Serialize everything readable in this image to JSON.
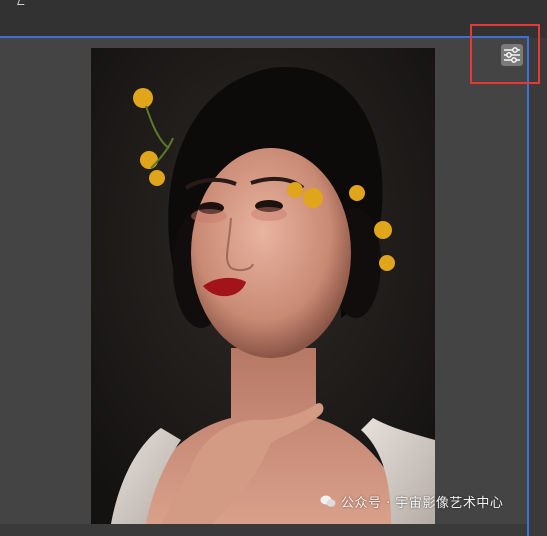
{
  "toolbar": {
    "adjust_icon": "sliders-icon"
  },
  "canvas": {
    "selection_color": "#3f6fd8",
    "highlight_color": "#e53935"
  },
  "photo": {
    "subject": "portrait"
  },
  "watermark": {
    "text": "公众号 · 宇宙影像艺术中心",
    "icon": "wechat-icon"
  }
}
